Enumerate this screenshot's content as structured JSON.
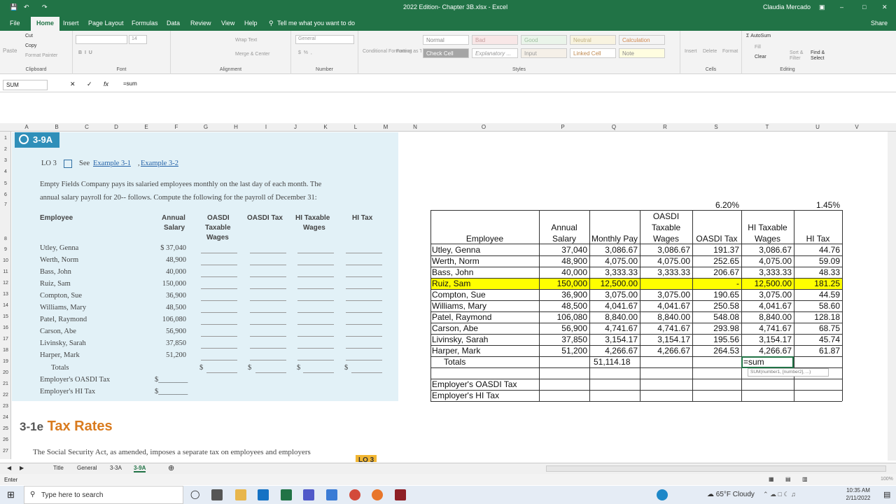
{
  "titlebar": {
    "file_title": "2022 Edition- Chapter 3B.xlsx - Excel",
    "user": "Claudia Mercado"
  },
  "menu": {
    "items": [
      "File",
      "Home",
      "Insert",
      "Page Layout",
      "Formulas",
      "Data",
      "Review",
      "View",
      "Help"
    ],
    "tell_me": "Tell me what you want to do",
    "share": "Share"
  },
  "ribbon": {
    "clipboard": {
      "cut": "Cut",
      "copy": "Copy",
      "paste": "Paste",
      "format_painter": "Format Painter",
      "label": "Clipboard"
    },
    "font": {
      "size": "14",
      "label": "Font"
    },
    "alignment": {
      "wrap_text": "Wrap Text",
      "merge_center": "Merge & Center",
      "label": "Alignment"
    },
    "number": {
      "format": "General",
      "label": "Number"
    },
    "styles": {
      "conditional": "Conditional Formatting",
      "format_table": "Format as Table",
      "normal": "Normal",
      "bad": "Bad",
      "good": "Good",
      "neutral": "Neutral",
      "calculation": "Calculation",
      "check_cell": "Check Cell",
      "explanatory": "Explanatory ...",
      "input": "Input",
      "linked_cell": "Linked Cell",
      "note": "Note",
      "label": "Styles"
    },
    "cells": {
      "insert": "Insert",
      "delete": "Delete",
      "format": "Format",
      "label": "Cells"
    },
    "editing": {
      "autosum": "AutoSum",
      "fill": "Fill",
      "clear": "Clear",
      "sort": "Sort & Filter",
      "find": "Find & Select",
      "label": "Editing"
    }
  },
  "formula_bar": {
    "name_box": "SUM",
    "formula": "=sum"
  },
  "columns": [
    "A",
    "B",
    "C",
    "D",
    "E",
    "F",
    "G",
    "H",
    "I",
    "J",
    "K",
    "L",
    "M",
    "N",
    "O",
    "P",
    "Q",
    "R",
    "S",
    "T",
    "U",
    "V"
  ],
  "rows": [
    "1",
    "2",
    "3",
    "4",
    "5",
    "6",
    "7",
    "8",
    "9",
    "10",
    "11",
    "12",
    "13",
    "14",
    "15",
    "16",
    "17",
    "18",
    "19",
    "20",
    "21",
    "22",
    "23",
    "24",
    "25",
    "26",
    "27"
  ],
  "textbook": {
    "badge": "3-9A",
    "lo": "LO 3",
    "see": "See",
    "ex1": "Example 3-1",
    "ex2": "Example 3-2",
    "p1": "Empty Fields Company pays its salaried employees monthly on the last day of each month. The",
    "p2": "annual salary payroll for 20-- follows. Compute the following for the payroll of December 31:",
    "h_employee": "Employee",
    "h_annual1": "Annual",
    "h_annual2": "Salary",
    "h_oasdi1": "OASDI",
    "h_oasdi2": "Taxable",
    "h_oasdi3": "Wages",
    "h_oasditax": "OASDI Tax",
    "h_hi1": "HI Taxable",
    "h_hi2": "Wages",
    "h_hitax": "HI Tax",
    "employees": [
      {
        "name": "Utley, Genna",
        "salary": "$ 37,040"
      },
      {
        "name": "Werth, Norm",
        "salary": "48,900"
      },
      {
        "name": "Bass, John",
        "salary": "40,000"
      },
      {
        "name": "Ruiz, Sam",
        "salary": "150,000"
      },
      {
        "name": "Compton, Sue",
        "salary": "36,900"
      },
      {
        "name": "Williams, Mary",
        "salary": "48,500"
      },
      {
        "name": "Patel, Raymond",
        "salary": "106,080"
      },
      {
        "name": "Carson, Abe",
        "salary": "56,900"
      },
      {
        "name": "Livinsky, Sarah",
        "salary": "37,850"
      },
      {
        "name": "Harper, Mark",
        "salary": "51,200"
      }
    ],
    "totals": "Totals",
    "emp_oasdi": "Employer's OASDI Tax",
    "emp_hi": "Employer's HI Tax",
    "dollar": "$",
    "dollar_line": "$________",
    "section_num": "3-1e",
    "section_title": "Tax Rates",
    "p3": "The Social Security Act, as amended, imposes a separate tax on employees and employers",
    "lo_tag": "LO 3"
  },
  "sheet": {
    "rate_oasdi": "6.20%",
    "rate_hi": "1.45%",
    "headers": {
      "employee": "Employee",
      "annual1": "Annual",
      "annual2": "Salary",
      "monthly": "Monthly Pay",
      "oasdi1": "OASDI",
      "oasdi2": "Taxable",
      "oasdi3": "Wages",
      "oasditax": "OASDI Tax",
      "hi1": "HI Taxable",
      "hi2": "Wages",
      "hitax": "HI Tax"
    },
    "rows": [
      {
        "name": "Utley, Genna",
        "annual": "37,040",
        "monthly": "3,086.67",
        "oasdi_wages": "3,086.67",
        "oasdi_tax": "191.37",
        "hi_wages": "3,086.67",
        "hi_tax": "44.76"
      },
      {
        "name": "Werth, Norm",
        "annual": "48,900",
        "monthly": "4,075.00",
        "oasdi_wages": "4,075.00",
        "oasdi_tax": "252.65",
        "hi_wages": "4,075.00",
        "hi_tax": "59.09"
      },
      {
        "name": "Bass, John",
        "annual": "40,000",
        "monthly": "3,333.33",
        "oasdi_wages": "3,333.33",
        "oasdi_tax": "206.67",
        "hi_wages": "3,333.33",
        "hi_tax": "48.33"
      },
      {
        "name": "Ruiz, Sam",
        "annual": "150,000",
        "monthly": "12,500.00",
        "oasdi_wages": "",
        "oasdi_tax": "-",
        "hi_wages": "12,500.00",
        "hi_tax": "181.25"
      },
      {
        "name": "Compton, Sue",
        "annual": "36,900",
        "monthly": "3,075.00",
        "oasdi_wages": "3,075.00",
        "oasdi_tax": "190.65",
        "hi_wages": "3,075.00",
        "hi_tax": "44.59"
      },
      {
        "name": "Williams, Mary",
        "annual": "48,500",
        "monthly": "4,041.67",
        "oasdi_wages": "4,041.67",
        "oasdi_tax": "250.58",
        "hi_wages": "4,041.67",
        "hi_tax": "58.60"
      },
      {
        "name": "Patel, Raymond",
        "annual": "106,080",
        "monthly": "8,840.00",
        "oasdi_wages": "8,840.00",
        "oasdi_tax": "548.08",
        "hi_wages": "8,840.00",
        "hi_tax": "128.18"
      },
      {
        "name": "Carson, Abe",
        "annual": "56,900",
        "monthly": "4,741.67",
        "oasdi_wages": "4,741.67",
        "oasdi_tax": "293.98",
        "hi_wages": "4,741.67",
        "hi_tax": "68.75"
      },
      {
        "name": "Livinsky, Sarah",
        "annual": "37,850",
        "monthly": "3,154.17",
        "oasdi_wages": "3,154.17",
        "oasdi_tax": "195.56",
        "hi_wages": "3,154.17",
        "hi_tax": "45.74"
      },
      {
        "name": "Harper, Mark",
        "annual": "51,200",
        "monthly": "4,266.67",
        "oasdi_wages": "4,266.67",
        "oasdi_tax": "264.53",
        "hi_wages": "4,266.67",
        "hi_tax": "61.87"
      }
    ],
    "totals_label": "Totals",
    "totals_monthly": "51,114.18",
    "editing_value": "=sum",
    "tooltip": "SUM(number1, [number2], ...)",
    "emp_oasdi": "Employer's OASDI Tax",
    "emp_hi": "Employer's HI Tax"
  },
  "tabs": [
    "Title",
    "General",
    "3-3A",
    "3-9A"
  ],
  "status": {
    "mode": "Enter",
    "zoom": "100%"
  },
  "taskbar": {
    "search": "Type here to search",
    "weather": "65°F  Cloudy",
    "time": "10:35 AM",
    "date": "2/11/2022"
  }
}
